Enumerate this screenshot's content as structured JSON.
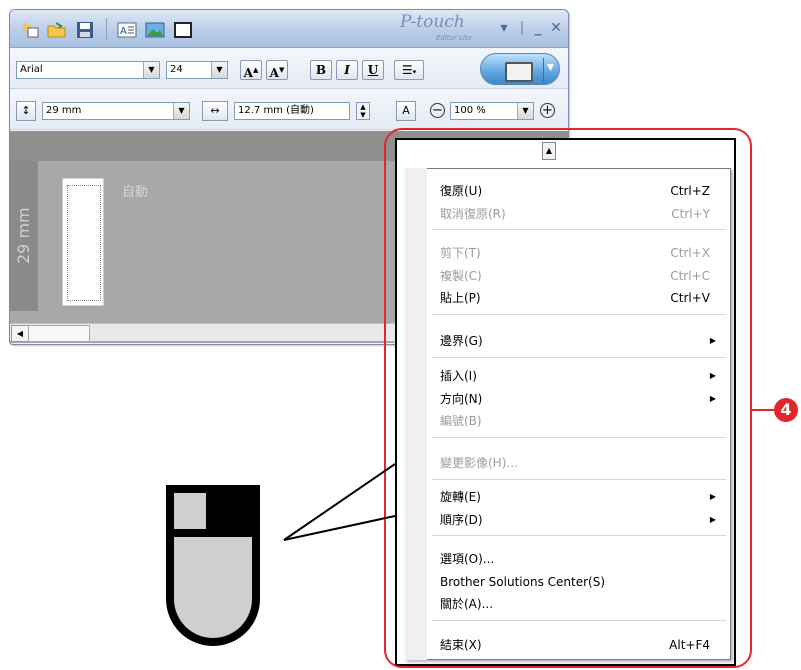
{
  "window": {
    "brand": "P-touch",
    "brand_sub": "Editor Lite",
    "controls": [
      "▾",
      "|",
      "_",
      "✕"
    ]
  },
  "toolbar1": {
    "font": "Arial",
    "size": "24",
    "buttons": {
      "grow": "A",
      "shrink": "A",
      "bold": "B",
      "italic": "I",
      "underline": "U",
      "align": "☰"
    }
  },
  "toolbar2": {
    "tape_width": "29 mm",
    "label_length": "12.7 mm (自動)",
    "zoom": "100 %"
  },
  "canvas": {
    "ruler_label": "29 mm",
    "auto_text": "自動"
  },
  "context_menu": {
    "groups": [
      [
        {
          "label": "復原(U)",
          "shortcut": "Ctrl+Z",
          "disabled": false,
          "submenu": false
        },
        {
          "label": "取消復原(R)",
          "shortcut": "Ctrl+Y",
          "disabled": true,
          "submenu": false
        }
      ],
      [
        {
          "label": "剪下(T)",
          "shortcut": "Ctrl+X",
          "disabled": true,
          "submenu": false
        },
        {
          "label": "複製(C)",
          "shortcut": "Ctrl+C",
          "disabled": true,
          "submenu": false
        },
        {
          "label": "貼上(P)",
          "shortcut": "Ctrl+V",
          "disabled": false,
          "submenu": false
        }
      ],
      [
        {
          "label": "邊界(G)",
          "shortcut": "",
          "disabled": false,
          "submenu": true
        }
      ],
      [
        {
          "label": "插入(I)",
          "shortcut": "",
          "disabled": false,
          "submenu": true
        },
        {
          "label": "方向(N)",
          "shortcut": "",
          "disabled": false,
          "submenu": true
        },
        {
          "label": "編號(B)",
          "shortcut": "",
          "disabled": true,
          "submenu": false
        }
      ],
      [
        {
          "label": "變更影像(H)...",
          "shortcut": "",
          "disabled": true,
          "submenu": false
        }
      ],
      [
        {
          "label": "旋轉(E)",
          "shortcut": "",
          "disabled": false,
          "submenu": true
        },
        {
          "label": "順序(D)",
          "shortcut": "",
          "disabled": false,
          "submenu": true
        }
      ],
      [
        {
          "label": "選項(O)...",
          "shortcut": "",
          "disabled": false,
          "submenu": false
        },
        {
          "label": "Brother Solutions Center(S)",
          "shortcut": "",
          "disabled": false,
          "submenu": false
        },
        {
          "label": "關於(A)...",
          "shortcut": "",
          "disabled": false,
          "submenu": false
        }
      ],
      [
        {
          "label": "結束(X)",
          "shortcut": "Alt+F4",
          "disabled": false,
          "submenu": false
        }
      ]
    ]
  },
  "callout": {
    "number": "4",
    "color": "#e3262b"
  }
}
